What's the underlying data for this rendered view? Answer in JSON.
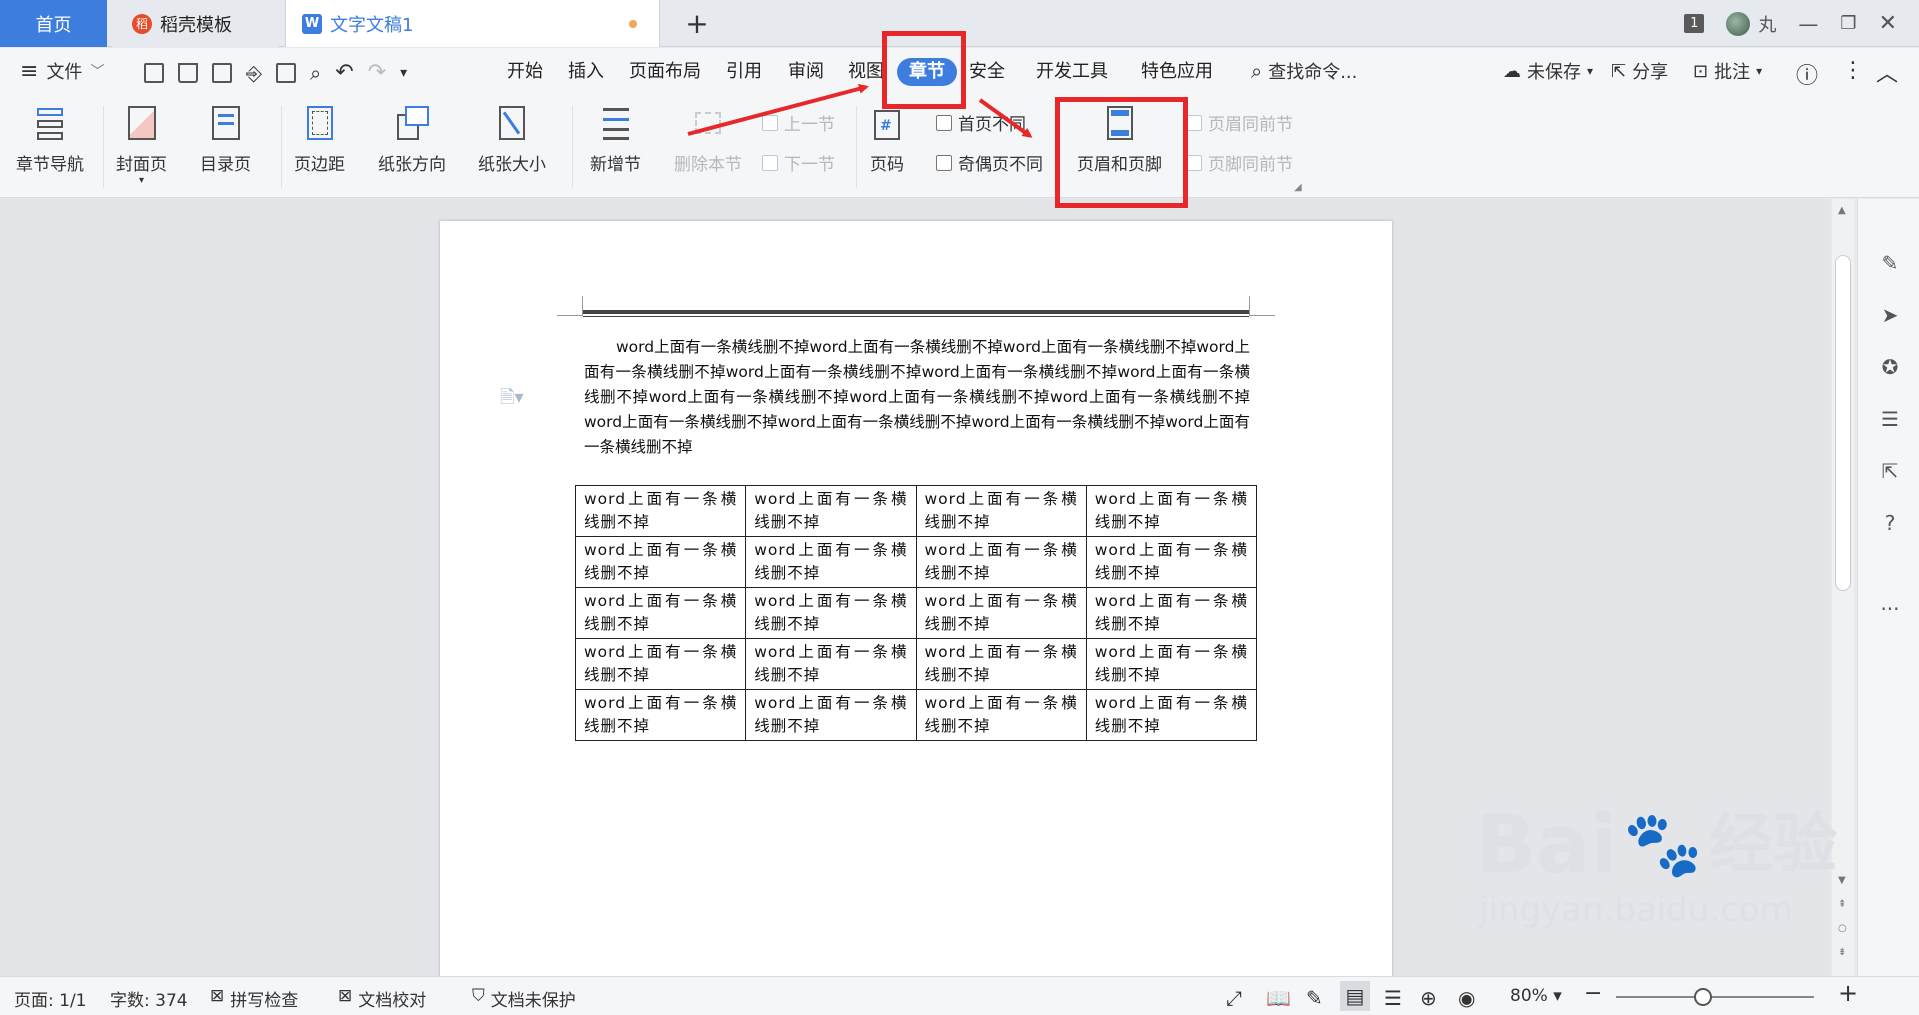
{
  "tabs": {
    "home": "首页",
    "template": "稻壳模板",
    "document": "文字文稿1",
    "add": "+"
  },
  "window": {
    "badge": "1",
    "user": "丸"
  },
  "menu": {
    "file": "文件",
    "items": [
      "开始",
      "插入",
      "页面布局",
      "引用",
      "审阅",
      "视图",
      "章节",
      "安全",
      "开发工具",
      "特色应用"
    ],
    "search": "查找命令...",
    "unsaved": "未保存",
    "share": "分享",
    "comment": "批注"
  },
  "ribbon": {
    "section_nav": "章节导航",
    "cover": "封面页",
    "toc": "目录页",
    "margin": "页边距",
    "orientation": "纸张方向",
    "size": "纸张大小",
    "new_section": "新增节",
    "delete_section": "删除本节",
    "prev_section": "上一节",
    "next_section": "下一节",
    "page_num": "页码",
    "first_page_diff": "首页不同",
    "odd_even_diff": "奇偶页不同",
    "header_footer": "页眉和页脚",
    "header_same": "页眉同前节",
    "footer_same": "页脚同前节"
  },
  "document": {
    "paragraph": "word上面有一条横线删不掉word上面有一条横线删不掉word上面有一条横线删不掉word上面有一条横线删不掉word上面有一条横线删不掉word上面有一条横线删不掉word上面有一条横线删不掉word上面有一条横线删不掉word上面有一条横线删不掉word上面有一条横线删不掉word上面有一条横线删不掉word上面有一条横线删不掉word上面有一条横线删不掉word上面有一条横线删不掉",
    "table": [
      [
        "word上面有一条横线删不掉",
        "word上面有一条横线删不掉",
        "word上面有一条横线删不掉",
        "word上面有一条横线删不掉"
      ],
      [
        "word上面有一条横线删不掉",
        "word上面有一条横线删不掉",
        "word上面有一条横线删不掉",
        "word上面有一条横线删不掉"
      ],
      [
        "word上面有一条横线删不掉",
        "word上面有一条横线删不掉",
        "word上面有一条横线删不掉",
        "word上面有一条横线删不掉"
      ],
      [
        "word上面有一条横线删不掉",
        "word上面有一条横线删不掉",
        "word上面有一条横线删不掉",
        "word上面有一条横线删不掉"
      ],
      [
        "word上面有一条横线删不掉",
        "word上面有一条横线删不掉",
        "word上面有一条横线删不掉",
        "word上面有一条横线删不掉"
      ]
    ]
  },
  "status": {
    "page": "页面: 1/1",
    "words": "字数: 374",
    "spell": "拼写检查",
    "proof": "文档校对",
    "protect": "文档未保护",
    "zoom": "80%"
  },
  "watermark": {
    "brand": "Bai",
    "jingyan": "经验",
    "url": "jingyan.baidu.com"
  },
  "colors": {
    "accent": "#3c7ddd",
    "annotation": "#e8272b"
  }
}
